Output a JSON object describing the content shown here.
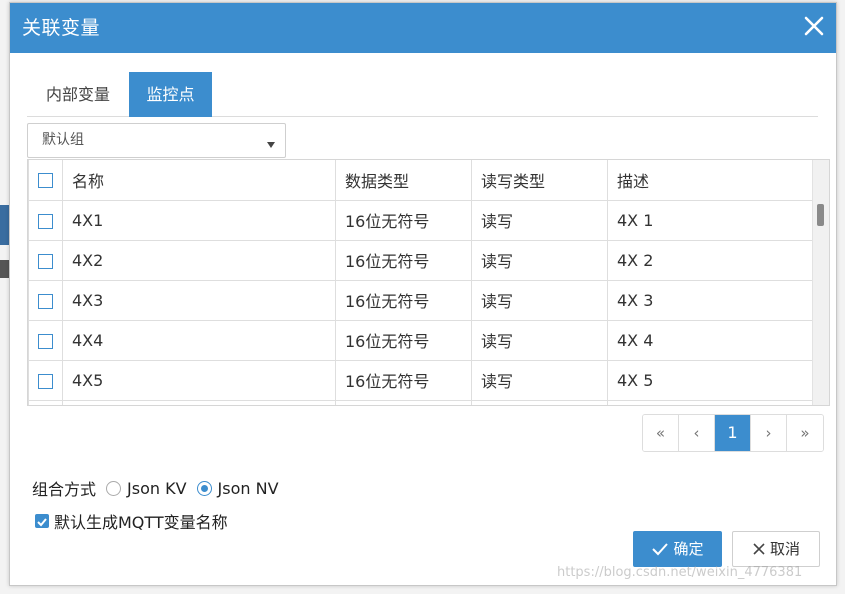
{
  "dialog": {
    "title": "关联变量",
    "close_icon": "close-icon"
  },
  "tabs": [
    {
      "label": "内部变量",
      "active": false
    },
    {
      "label": "监控点",
      "active": true
    }
  ],
  "group_select": {
    "value": "默认组",
    "icon": "caret-down-icon"
  },
  "table": {
    "headers": {
      "name": "名称",
      "data_type": "数据类型",
      "rw_type": "读写类型",
      "description": "描述"
    },
    "rows": [
      {
        "name": "4X1",
        "data_type": "16位无符号",
        "rw_type": "读写",
        "description": "4X 1"
      },
      {
        "name": "4X2",
        "data_type": "16位无符号",
        "rw_type": "读写",
        "description": "4X 2"
      },
      {
        "name": "4X3",
        "data_type": "16位无符号",
        "rw_type": "读写",
        "description": "4X 3"
      },
      {
        "name": "4X4",
        "data_type": "16位无符号",
        "rw_type": "读写",
        "description": "4X 4"
      },
      {
        "name": "4X5",
        "data_type": "16位无符号",
        "rw_type": "读写",
        "description": "4X 5"
      }
    ]
  },
  "pager": {
    "first": "«",
    "prev": "‹",
    "current": "1",
    "next": "›",
    "last": "»"
  },
  "combine": {
    "label": "组合方式",
    "options": [
      {
        "label": "Json KV",
        "selected": false
      },
      {
        "label": "Json NV",
        "selected": true
      }
    ]
  },
  "default_name": {
    "label": "默认生成MQTT变量名称",
    "checked": true
  },
  "buttons": {
    "ok_label": "确定",
    "cancel_label": "取消"
  },
  "watermark": "https://blog.csdn.net/weixin_4776381",
  "colors": {
    "accent": "#3c8dce",
    "titlebar": "#3c8dce",
    "border": "#dedede"
  }
}
